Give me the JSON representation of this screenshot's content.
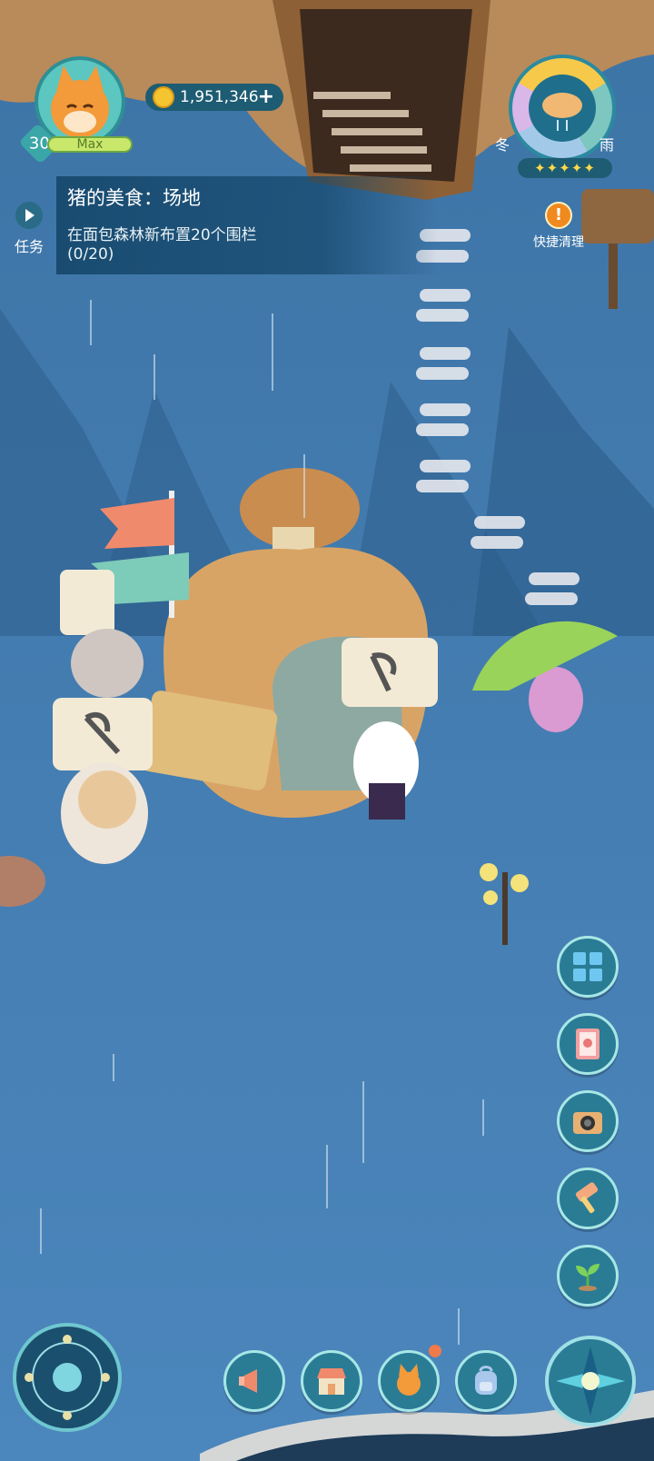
{
  "hud": {
    "level": "30",
    "exp_label": "Max",
    "coins": "1,951,346"
  },
  "task": {
    "tab_label": "任务",
    "title": "猪的美食：场地",
    "description": "在面包森林新布置20个围栏",
    "progress": "(0/20)"
  },
  "weather": {
    "season": "冬",
    "condition": "雨",
    "stars": "✦✦✦✦✦"
  },
  "quick_clean": {
    "label": "快捷清理"
  },
  "icons": {
    "side": [
      "layout-icon",
      "book-icon",
      "camera-icon",
      "hammer-icon",
      "sprout-icon"
    ],
    "bottom": [
      "megaphone-icon",
      "shop-icon",
      "fox-icon",
      "backpack-icon"
    ],
    "corners": [
      "compass-icon",
      "navigation-icon"
    ]
  },
  "colors": {
    "water": "#3f78ad",
    "hud_dark": "#1d5c72",
    "button_teal": "#2a7c95",
    "coin_gold": "#f4c431"
  }
}
